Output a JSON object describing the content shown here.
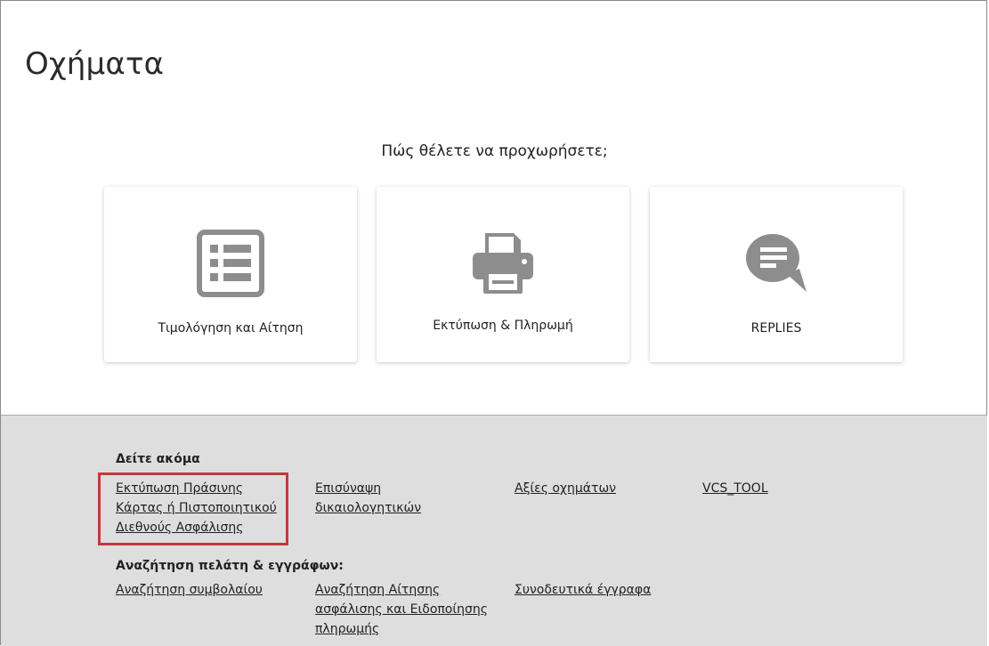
{
  "page": {
    "title": "Οχήματα"
  },
  "prompt": "Πώς θέλετε να προχωρήσετε;",
  "cards": [
    {
      "label": "Τιμολόγηση και Αίτηση",
      "icon": "list-document-icon"
    },
    {
      "label": "Εκτύπωση & Πληρωμή",
      "icon": "printer-icon"
    },
    {
      "label": "REPLIES",
      "icon": "chat-bubble-icon"
    }
  ],
  "colors": {
    "icon_gray": "#8d8d8d",
    "highlight": "#c0393d",
    "footer_bg": "#dedede"
  },
  "footer": {
    "see_also": {
      "title": "Δείτε ακόμα",
      "links": [
        "Εκτύπωση Πράσινης Κάρτας ή Πιστοποιητικού Διεθνούς Ασφάλισης",
        "Επισύναψη δικαιολογητικών",
        "Αξίες οχημάτων",
        "VCS_TOOL"
      ]
    },
    "search": {
      "title": "Αναζήτηση πελάτη & εγγράφων:",
      "links": [
        "Αναζήτηση συμβολαίου",
        "Αναζήτηση Αίτησης ασφάλισης και Ειδοποίησης πληρωμής",
        "Συνοδευτικά έγγραφα"
      ]
    }
  }
}
